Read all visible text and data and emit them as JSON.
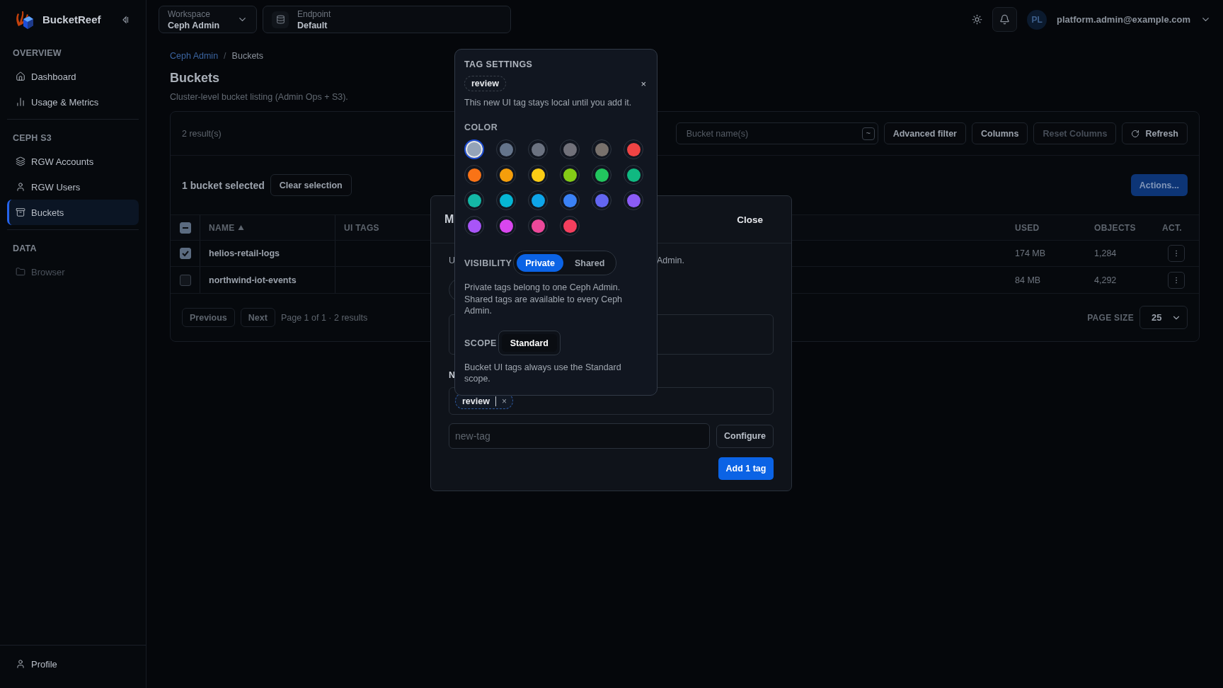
{
  "app": {
    "name": "BucketReef"
  },
  "sidebar": {
    "sections": [
      {
        "title": "OVERVIEW",
        "items": [
          {
            "label": "Dashboard",
            "selected": false,
            "disabled": false
          },
          {
            "label": "Usage & Metrics",
            "selected": false,
            "disabled": false
          }
        ]
      },
      {
        "title": "CEPH S3",
        "items": [
          {
            "label": "RGW Accounts",
            "selected": false,
            "disabled": false
          },
          {
            "label": "RGW Users",
            "selected": false,
            "disabled": false
          },
          {
            "label": "Buckets",
            "selected": true,
            "disabled": false
          }
        ]
      },
      {
        "title": "DATA",
        "items": [
          {
            "label": "Browser",
            "selected": false,
            "disabled": true
          }
        ]
      }
    ],
    "footer": {
      "label": "Profile"
    }
  },
  "topbar": {
    "workspace": {
      "label": "Workspace",
      "value": "Ceph Admin"
    },
    "endpoint": {
      "label": "Endpoint",
      "value": "Default"
    },
    "user": {
      "initials": "PL",
      "email": "platform.admin@example.com"
    }
  },
  "breadcrumb": {
    "separator": "/",
    "items": [
      {
        "label": "Ceph Admin",
        "link": true
      },
      {
        "label": "Buckets",
        "link": false
      }
    ]
  },
  "page": {
    "title": "Buckets",
    "subtitle": "Cluster-level bucket listing (Admin Ops + S3)."
  },
  "toolbar": {
    "result_count": "2 result(s)",
    "search": {
      "placeholder": "Bucket name(s)",
      "mode": "~"
    },
    "buttons": [
      {
        "label": "Advanced filter",
        "disabled": false
      },
      {
        "label": "Columns",
        "disabled": false
      },
      {
        "label": "Reset Columns",
        "disabled": true
      },
      {
        "label": "Refresh",
        "disabled": false
      }
    ]
  },
  "selection": {
    "text": "1 bucket selected",
    "clear": "Clear selection",
    "actions": "Actions..."
  },
  "table": {
    "select_all_partial": true,
    "columns": [
      {
        "label": "NAME",
        "sorted": true
      },
      {
        "label": "UI TAGS",
        "sorted": false
      },
      {
        "label": "USED",
        "sorted": false
      },
      {
        "label": "OBJECTS",
        "sorted": false
      },
      {
        "label": "ACT.",
        "sorted": false
      }
    ],
    "rows": [
      {
        "selected": true,
        "name": "helios-retail-logs",
        "used": "174 MB",
        "objects": "1,284"
      },
      {
        "selected": false,
        "name": "northwind-iot-events",
        "used": "84 MB",
        "objects": "4,292"
      }
    ]
  },
  "pagination": {
    "previous": "Previous",
    "next": "Next",
    "info": "Page 1 of 1 · 2 results",
    "page_size_label": "PAGE SIZE",
    "page_size": "25"
  },
  "modal": {
    "title": "M",
    "close": "Close",
    "description_start": "U",
    "description_end": "Admin.",
    "label": "N",
    "tags": [
      {
        "label": "review",
        "close": "×"
      }
    ],
    "input": {
      "placeholder": "new-tag"
    },
    "configure": "Configure",
    "submit": "Add 1 tag"
  },
  "popover": {
    "title": "TAG SETTINGS",
    "tag": "review",
    "close": "×",
    "note": "This new UI tag stays local until you add it.",
    "color_label": "COLOR",
    "colors": [
      {
        "color": "#94a3b8",
        "selected": true
      },
      {
        "color": "#64748b",
        "selected": false
      },
      {
        "color": "#6b7280",
        "selected": false
      },
      {
        "color": "#71717a",
        "selected": false
      },
      {
        "color": "#78716c",
        "selected": false
      },
      {
        "color": "#ef4444",
        "selected": false
      },
      {
        "color": "#f97316",
        "selected": false
      },
      {
        "color": "#f59e0b",
        "selected": false
      },
      {
        "color": "#facc15",
        "selected": false
      },
      {
        "color": "#84cc16",
        "selected": false
      },
      {
        "color": "#22c55e",
        "selected": false
      },
      {
        "color": "#10b981",
        "selected": false
      },
      {
        "color": "#14b8a6",
        "selected": false
      },
      {
        "color": "#06b6d4",
        "selected": false
      },
      {
        "color": "#0ea5e9",
        "selected": false
      },
      {
        "color": "#3b82f6",
        "selected": false
      },
      {
        "color": "#6366f1",
        "selected": false
      },
      {
        "color": "#8b5cf6",
        "selected": false
      },
      {
        "color": "#a855f7",
        "selected": false
      },
      {
        "color": "#d946ef",
        "selected": false
      },
      {
        "color": "#ec4899",
        "selected": false
      },
      {
        "color": "#f43f5e",
        "selected": false
      }
    ],
    "visibility": {
      "label": "VISIBILITY",
      "options": [
        {
          "label": "Private",
          "selected": true
        },
        {
          "label": "Shared",
          "selected": false
        }
      ],
      "help": "Private tags belong to one Ceph Admin. Shared tags are available to every Ceph Admin."
    },
    "scope": {
      "label": "SCOPE",
      "options": [
        {
          "label": "Standard",
          "selected": true
        }
      ],
      "help": "Bucket UI tags always use the Standard scope."
    }
  }
}
